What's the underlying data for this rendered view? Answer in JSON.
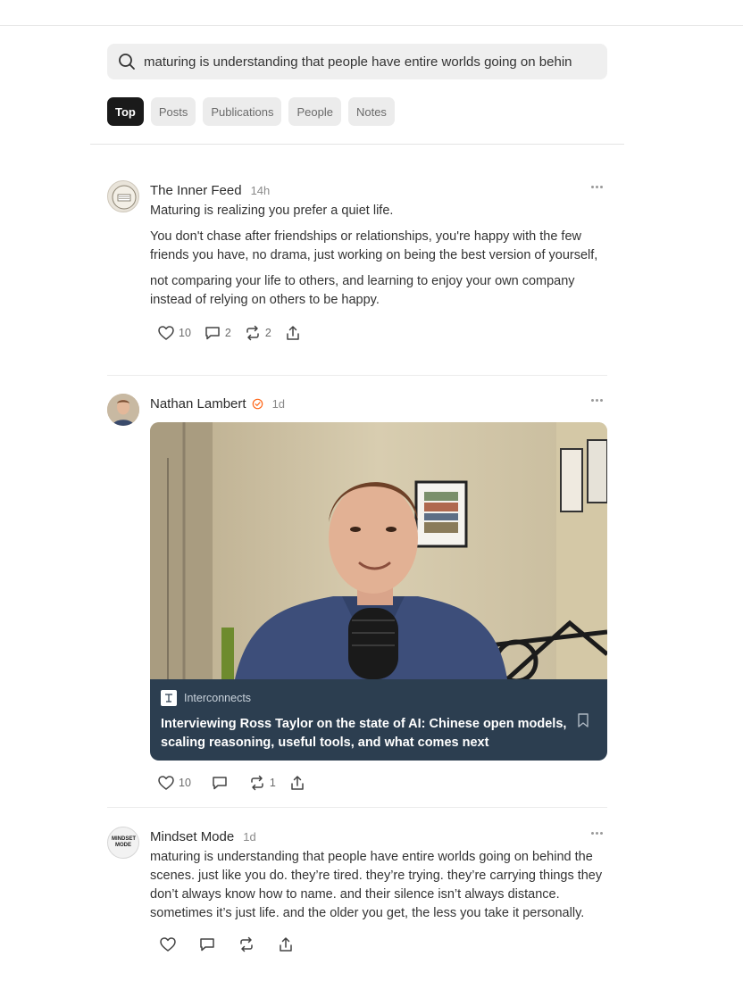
{
  "search": {
    "query": "maturing is understanding that people have entire worlds going on behin"
  },
  "tabs": [
    {
      "label": "Top",
      "active": true
    },
    {
      "label": "Posts",
      "active": false
    },
    {
      "label": "Publications",
      "active": false
    },
    {
      "label": "People",
      "active": false
    },
    {
      "label": "Notes",
      "active": false
    }
  ],
  "notes": [
    {
      "author": "The Inner Feed",
      "time": "14h",
      "avatar_icon": "inner-feed-logo",
      "paragraphs": [
        "Maturing is realizing you prefer a quiet life.",
        "You don't chase after friendships or relationships, you're happy with the few friends you have, no drama, just working on being the best version of yourself,",
        "not comparing your life to others, and learning to enjoy your own company instead of relying on others to be happy."
      ],
      "likes": "10",
      "comments": "2",
      "restacks": "2"
    },
    {
      "author": "Nathan Lambert",
      "time": "1d",
      "verified": true,
      "card": {
        "publication": "Interconnects",
        "title": "Interviewing Ross Taylor on the state of AI: Chinese open models, scaling reasoning, useful tools, and what comes next"
      },
      "likes": "10",
      "comments": "",
      "restacks": "1"
    },
    {
      "author": "Mindset Mode",
      "time": "1d",
      "avatar_text": "MINDSET MODE",
      "paragraphs": [
        "maturing is understanding that people have entire worlds going on behind the scenes. just like you do. they’re tired. they’re trying. they’re carrying things they don’t always know how to name. and their silence isn’t always distance. sometimes it’s just life. and the older you get, the less you take it personally."
      ],
      "likes": "",
      "comments": "",
      "restacks": ""
    }
  ],
  "colors": {
    "accent": "#ff6719",
    "card_bg": "#2c3e50",
    "tab_active": "#1a1a1a"
  }
}
